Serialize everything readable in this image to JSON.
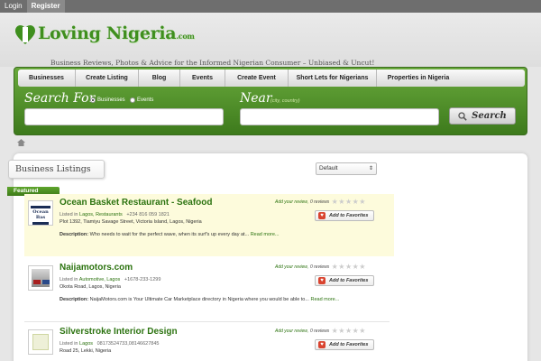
{
  "topbar": {
    "login": "Login",
    "register": "Register"
  },
  "header": {
    "logo_text": "Loving Nigeria",
    "logo_suffix": ".com",
    "tagline": "Business Reviews, Photos & Advice for the Informed Nigerian Consumer – Unbiased & Uncut!"
  },
  "nav": {
    "items": [
      {
        "label": "Businesses"
      },
      {
        "label": "Create Listing"
      },
      {
        "label": "Blog"
      },
      {
        "label": "Events"
      },
      {
        "label": "Create Event"
      },
      {
        "label": "Short Lets for Nigerians"
      },
      {
        "label": "Properties in Nigeria"
      }
    ]
  },
  "search": {
    "for_label": "Search For",
    "near_label": "Near",
    "near_hint": "(city, country)",
    "radio_businesses": "Businesses",
    "radio_events": "Events",
    "button": "Search"
  },
  "listings_panel": {
    "title": "Business Listings",
    "sort_value": "Default",
    "featured_label": "Featured",
    "add_review": "Add your review,",
    "favorites_label": "Add to Favorites",
    "description_label": "Description:",
    "read_more": "Read more...",
    "listed_in": "Listed in"
  },
  "listings": [
    {
      "name": "Ocean Basket Restaurant - Seafood",
      "category": "Lagos, Restaurants",
      "phone": "+234 816 059 1821",
      "address": "Plot 1392, Tiamiyu Savage Street, Victoria Island, Lagos, Nigeria",
      "description": "Who needs to wait for the perfect wave, when its surf's up every day at...",
      "reviews": "0 reviews",
      "thumb_text": "Ocean Bas",
      "featured": true
    },
    {
      "name": "Naijamotors.com",
      "category": "Automotive, Lagos",
      "phone": "+1678-233-1299",
      "address": "Okota Road, Lagos, Nigeria",
      "description": "NaijaMotors.com is Your Ultimate Car Marketplace directory in Nigeria where you would be able to...",
      "reviews": "0 reviews",
      "featured": false
    },
    {
      "name": "Silverstroke Interior Design",
      "category": "Lagos",
      "phone": "08173524733,08146627845",
      "address": "Road 25, Lekki, Nigeria",
      "description": "",
      "reviews": "0 reviews",
      "featured": false
    }
  ],
  "colors": {
    "brand_green": "#3f8f1e",
    "nav_green_top": "#69a93c",
    "nav_green_bottom": "#3d7a1c",
    "featured_bg": "#fdfbdc",
    "favorite_red": "#d9432f"
  }
}
